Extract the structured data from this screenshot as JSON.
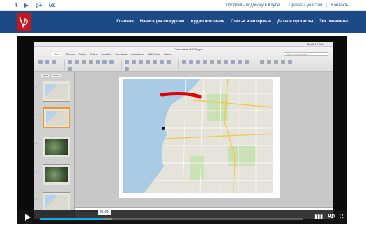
{
  "topbar": {
    "social": [
      "f",
      "▶",
      "g+",
      "vk"
    ],
    "links": [
      "Продлить подписку в Клубе",
      "Правила участия",
      "Контакты"
    ]
  },
  "nav": {
    "items": [
      "Главная",
      "Навигация по курсам",
      "Аудио послания",
      "Статьи и интервью",
      "Даты и прогнозы",
      "Тех. моменты"
    ]
  },
  "screen": {
    "mac_menu": [
      "PowerPoint",
      "File",
      "Edit",
      "View",
      "Insert",
      "Format",
      "Arrange",
      "Tools",
      "Slide Show",
      "Window",
      "Help"
    ],
    "clock": "Thu 6:12 PM",
    "file_title": "Presentation 1 KEI.pptx",
    "ribbon_tabs": [
      "Home",
      "Themes",
      "Tables",
      "Charts",
      "SmartArt",
      "Transitions",
      "Animations",
      "Slide Show",
      "Review"
    ],
    "search_placeholder": "Search in Presentation",
    "panel_tabs": [
      "Slides",
      "Outline"
    ],
    "slide_numbers": [
      "2",
      "3",
      "4",
      "5",
      "6"
    ],
    "notes_placeholder": "Click to add notes"
  },
  "player": {
    "time": "25:29",
    "progress": 0.24,
    "buffered": 0.27,
    "hd_label": "HD"
  },
  "colors": {
    "nav_bg": "#1d4a86",
    "logo": "#c4161c",
    "progress": "#00adef",
    "selected_thumb": "#e69b2c"
  }
}
